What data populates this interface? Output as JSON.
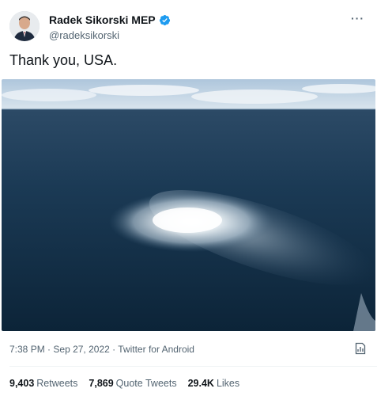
{
  "author": {
    "display_name": "Radek Sikorski MEP",
    "handle": "@radeksikorski",
    "verified": true,
    "avatar_icon": "profile-photo"
  },
  "menu_icon": "more-options-icon",
  "tweet": {
    "text": "Thank you, USA.",
    "time": "7:38 PM",
    "date": "Sep 27, 2022",
    "source": "Twitter for Android",
    "separator": "·"
  },
  "stats": {
    "retweets_count": "9,403",
    "retweets_label": "Retweets",
    "quote_count": "7,869",
    "quote_label": "Quote Tweets",
    "likes_count": "29.4K",
    "likes_label": "Likes"
  },
  "colors": {
    "text_primary": "#0f1419",
    "text_secondary": "#536471",
    "verified_blue": "#1d9bf0",
    "sea_dark": "#0f2d45"
  }
}
